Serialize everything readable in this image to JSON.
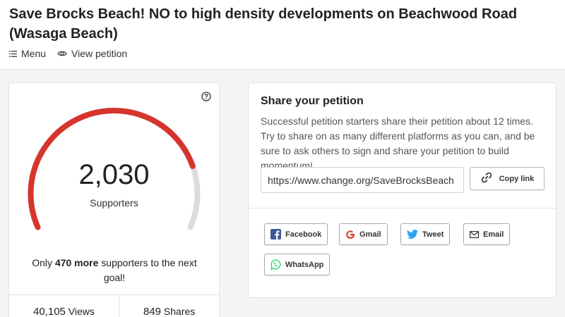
{
  "page": {
    "title": "Save Brocks Beach! NO to high density developments on Beachwood Road (Wasaga Beach)"
  },
  "nav": {
    "menu_label": "Menu",
    "view_petition_label": "View petition"
  },
  "progress": {
    "count": "2,030",
    "count_label": "Supporters",
    "goal_prefix": "Only ",
    "goal_more": "470 more",
    "goal_suffix": " supporters to the next goal!",
    "fraction_toward_goal": 0.81,
    "views_num": "40,105",
    "views_label": " Views",
    "shares_num": "849",
    "shares_label": " Shares"
  },
  "share": {
    "title": "Share your petition",
    "description": "Successful petition starters share their petition about 12 times. Try to share on as many different platforms as you can, and be sure to ask others to sign and share your petition to build momentum!",
    "link": "https://www.change.org/SaveBrocksBeach",
    "copy_label": "Copy link",
    "buttons": {
      "facebook": "Facebook",
      "gmail": "Gmail",
      "tweet": "Tweet",
      "email": "Email",
      "whatsapp": "WhatsApp"
    }
  },
  "colors": {
    "gauge_fill": "#d5352c",
    "gauge_track": "#dcdcdc",
    "facebook": "#3b5998",
    "twitter": "#2aa3ef",
    "gmail_red": "#db4437",
    "whatsapp": "#25d366"
  },
  "icons": {
    "menu": "list-icon",
    "view_petition": "eye-icon",
    "help": "question-circle-icon",
    "copy": "link-icon",
    "facebook": "facebook-icon",
    "gmail": "google-icon",
    "tweet": "twitter-bird-icon",
    "email": "envelope-icon",
    "whatsapp": "whatsapp-icon"
  }
}
